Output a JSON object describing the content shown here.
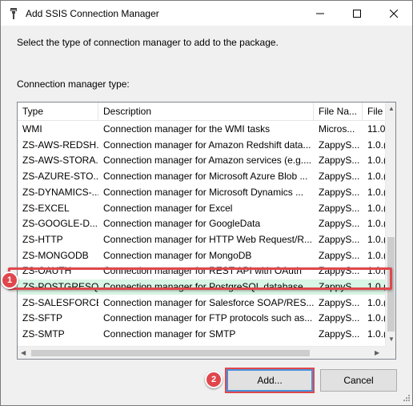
{
  "window": {
    "title": "Add SSIS Connection Manager",
    "minimize_icon": "minimize-icon",
    "maximize_icon": "maximize-icon",
    "close_icon": "close-icon"
  },
  "prompt_text": "Select the type of connection manager to add to the package.",
  "list_label": "Connection manager type:",
  "columns": [
    "Type",
    "Description",
    "File Na...",
    "File"
  ],
  "rows": [
    {
      "type": "WMI",
      "description": "Connection manager for the WMI tasks",
      "file_name": "Micros...",
      "file_version": "11.0"
    },
    {
      "type": "ZS-AWS-REDSH...",
      "description": "Connection manager for Amazon Redshift data...",
      "file_name": "ZappyS...",
      "file_version": "1.0.("
    },
    {
      "type": "ZS-AWS-STORA...",
      "description": "Connection manager for Amazon services (e.g....",
      "file_name": "ZappyS...",
      "file_version": "1.0.("
    },
    {
      "type": "ZS-AZURE-STO...",
      "description": "Connection manager for Microsoft Azure Blob ...",
      "file_name": "ZappyS...",
      "file_version": "1.0.("
    },
    {
      "type": "ZS-DYNAMICS-...",
      "description": "Connection manager for Microsoft Dynamics ...",
      "file_name": "ZappyS...",
      "file_version": "1.0.("
    },
    {
      "type": "ZS-EXCEL",
      "description": "Connection manager for Excel",
      "file_name": "ZappyS...",
      "file_version": "1.0.("
    },
    {
      "type": "ZS-GOOGLE-D...",
      "description": "Connection manager for GoogleData",
      "file_name": "ZappyS...",
      "file_version": "1.0.("
    },
    {
      "type": "ZS-HTTP",
      "description": "Connection manager for HTTP Web Request/R...",
      "file_name": "ZappyS...",
      "file_version": "1.0.("
    },
    {
      "type": "ZS-MONGODB",
      "description": "Connection manager for MongoDB",
      "file_name": "ZappyS...",
      "file_version": "1.0.("
    },
    {
      "type": "ZS-OAUTH",
      "description": "Connection manager for REST API with OAuth",
      "file_name": "ZappyS...",
      "file_version": "1.0.("
    },
    {
      "type": "ZS-POSTGRESQL",
      "description": "Connection manager for PostgreSQL database",
      "file_name": "ZappyS...",
      "file_version": "1.0.("
    },
    {
      "type": "ZS-SALESFORCE",
      "description": "Connection manager for Salesforce SOAP/RES...",
      "file_name": "ZappyS...",
      "file_version": "1.0.("
    },
    {
      "type": "ZS-SFTP",
      "description": "Connection manager for FTP protocols such as...",
      "file_name": "ZappyS...",
      "file_version": "1.0.("
    },
    {
      "type": "ZS-SMTP",
      "description": "Connection manager for SMTP",
      "file_name": "ZappyS...",
      "file_version": "1.0.("
    }
  ],
  "selected_row": "ZS-POSTGRESQL",
  "annotations": {
    "step1": "1",
    "step2": "2",
    "color": "#e0474c"
  },
  "buttons": {
    "add": "Add...",
    "cancel": "Cancel"
  },
  "colors": {
    "selection": "#d8f5e5",
    "focus_border": "#4a90d9"
  }
}
